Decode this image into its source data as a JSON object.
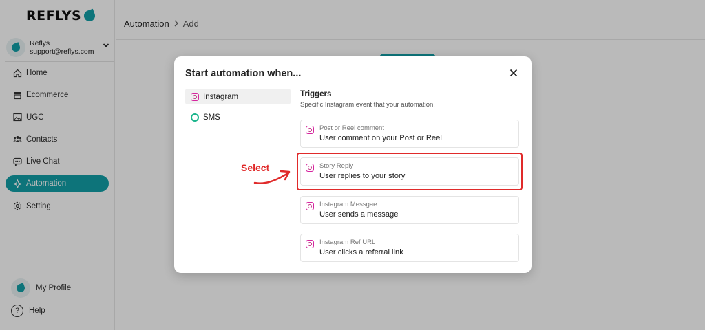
{
  "brand": {
    "name": "REFLYS",
    "accent": "#13a0a8"
  },
  "account": {
    "name": "Reflys",
    "email": "support@reflys.com"
  },
  "sidebar": {
    "items": [
      {
        "label": "Home",
        "icon": "home-icon"
      },
      {
        "label": "Ecommerce",
        "icon": "store-icon"
      },
      {
        "label": "UGC",
        "icon": "image-icon"
      },
      {
        "label": "Contacts",
        "icon": "users-icon"
      },
      {
        "label": "Live Chat",
        "icon": "chat-icon"
      },
      {
        "label": "Automation",
        "icon": "automation-icon",
        "active": true
      },
      {
        "label": "Setting",
        "icon": "gear-icon"
      }
    ],
    "profile_label": "My Profile",
    "help_label": "Help"
  },
  "breadcrumb": {
    "parent": "Automation",
    "current": "Add"
  },
  "modal": {
    "title": "Start automation when...",
    "channels": [
      {
        "label": "Instagram",
        "icon": "instagram-icon",
        "selected": true
      },
      {
        "label": "SMS",
        "icon": "sms-icon"
      }
    ],
    "triggers_heading": "Triggers",
    "triggers_subheading": "Specific Instagram event that your automation.",
    "triggers": [
      {
        "title": "Post or Reel comment",
        "description": "User comment on your Post or Reel"
      },
      {
        "title": "Story Reply",
        "description": "User replies to your story",
        "highlighted": true
      },
      {
        "title": "Instagram Messgae",
        "description": "User sends a message"
      },
      {
        "title": "Instagram Ref URL",
        "description": "User clicks a referral link"
      }
    ]
  },
  "annotation": {
    "label": "Select",
    "color": "#e02a2a"
  }
}
